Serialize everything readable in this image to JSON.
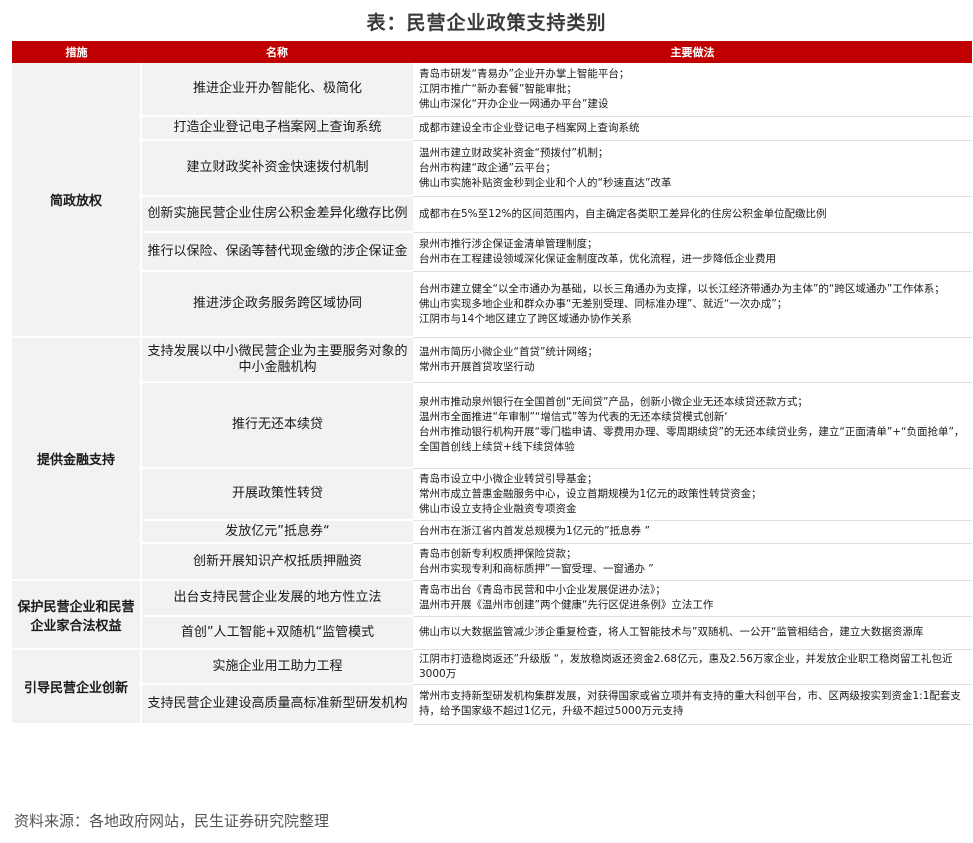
{
  "title": "表：民营企业政策支持类别",
  "headers": [
    "措施",
    "名称",
    "主要做法"
  ],
  "rows": [
    {
      "category": "简政放权",
      "span": 6,
      "name": "推进企业开办智能化、极简化",
      "practices": [
        "青岛市研发“青易办”企业开办掌上智能平台；",
        "江阴市推广“新办套餐”智能审批；",
        "佛山市深化“开办企业一网通办平台”建设"
      ]
    },
    {
      "name": "打造企业登记电子档案网上查询系统",
      "practices": [
        "成都市建设全市企业登记电子档案网上查询系统"
      ]
    },
    {
      "name": "建立财政奖补资金快速拨付机制",
      "practices": [
        "温州市建立财政奖补资金“预拨付”机制；",
        "台州市构建“政企通”云平台；",
        "佛山市实施补贴资金秒到企业和个人的“秒速直达”改革"
      ]
    },
    {
      "name": "创新实施民营企业住房公积金差异化缴存比例",
      "practices": [
        "成都市在5%至12%的区间范围内，自主确定各类职工差异化的住房公积金单位配缴比例"
      ]
    },
    {
      "name": "推行以保险、保函等替代现金缴的涉企保证金",
      "practices": [
        "泉州市推行涉企保证金清单管理制度；",
        "台州市在工程建设领域深化保证金制度改革，优化流程，进一步降低企业费用"
      ]
    },
    {
      "name": "推进涉企政务服务跨区域协同",
      "practices": [
        "台州市建立健全“以全市通办为基础，以长三角通办为支撑，以长江经济带通办为主体”的“跨区域通办”工作体系；",
        "佛山市实现多地企业和群众办事“无差别受理、同标准办理”、就近“一次办成”；",
        "江阴市与14个地区建立了跨区域通办协作关系"
      ]
    },
    {
      "category": "提供金融支持",
      "span": 5,
      "name": "支持发展以中小微民营企业为主要服务对象的中小金融机构",
      "practices": [
        "温州市简历小微企业“首贷”统计网络；",
        "常州市开展首贷攻坚行动"
      ]
    },
    {
      "name": "推行无还本续贷",
      "practices": [
        "泉州市推动泉州银行在全国首创“无间贷”产品，创新小微企业无还本续贷还款方式；",
        "温州市全面推进“年审制”“增信式”等为代表的无还本续贷模式创新‘",
        "台州市推动银行机构开展“零门槛申请、零费用办理、零周期续贷”的无还本续贷业务，建立“正面清单”+“负面抢单”，全国首创线上续贷+线下续贷体验"
      ]
    },
    {
      "name": "开展政策性转贷",
      "practices": [
        "青岛市设立中小微企业转贷引导基金；",
        "常州市成立普惠金融服务中心，设立首期规模为1亿元的政策性转贷资金；",
        "佛山市设立支持企业融资专项资金"
      ]
    },
    {
      "name": "发放亿元”抵息券“",
      "practices": [
        "台州市在浙江省内首发总规模为1亿元的”抵息券 ”"
      ]
    },
    {
      "name": "创新开展知识产权抵质押融资",
      "practices": [
        "青岛市创新专利权质押保险贷款；",
        "台州市实现专利和商标质押”一窗受理、一窗通办 ”"
      ]
    },
    {
      "category": "保护民营企业和民营企业家合法权益",
      "span": 2,
      "name": "出台支持民营企业发展的地方性立法",
      "practices": [
        "青岛市出台《青岛市民营和中小企业发展促进办法》；",
        "温州市开展《温州市创建”两个健康“先行区促进条例》立法工作"
      ]
    },
    {
      "name": "首创”人工智能+双随机“监管模式",
      "practices": [
        "佛山市以大数据监管减少涉企重复检查，将人工智能技术与”双随机、一公开“监管相结合，建立大数据资源库"
      ]
    },
    {
      "category": "引导民营企业创新",
      "span": 2,
      "name": "实施企业用工助力工程",
      "practices": [
        "江阴市打造稳岗返还”升级版 “，发放稳岗返还资金2.68亿元，惠及2.56万家企业，并发放企业职工稳岗留工礼包近3000万"
      ]
    },
    {
      "name": "支持民营企业建设高质量高标准新型研发机构",
      "practices": [
        "常州市支持新型研发机构集群发展，对获得国家或省立项并有支持的重大科创平台，市、区两级按实到资金1:1配套支持，给予国家级不超过1亿元，升级不超过5000万元支持"
      ]
    }
  ],
  "source": "资料来源：各地政府网站，民生证券研究院整理"
}
